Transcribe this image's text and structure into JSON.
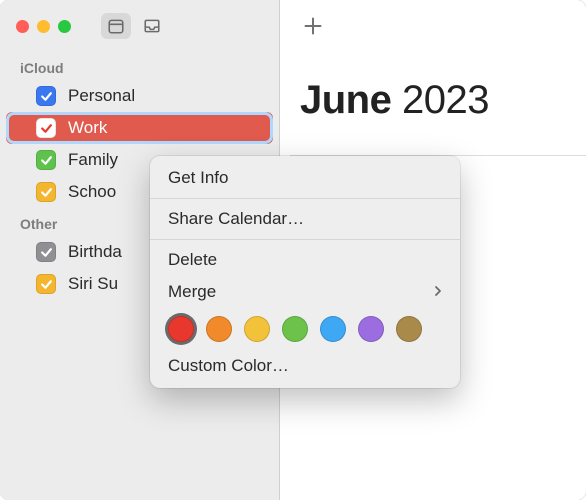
{
  "header": {
    "month": "June",
    "year": "2023"
  },
  "sidebar": {
    "sections": [
      {
        "label": "iCloud",
        "items": [
          {
            "label": "Personal",
            "color": "#3a78f2",
            "checked": true,
            "selected": false
          },
          {
            "label": "Work",
            "color": "#e8382e",
            "checked": true,
            "selected": true
          },
          {
            "label": "Family",
            "color": "#5fc24c",
            "checked": true,
            "selected": false
          },
          {
            "label": "School",
            "color": "#f3b62e",
            "checked": true,
            "selected": false
          }
        ]
      },
      {
        "label": "Other",
        "items": [
          {
            "label": "Birthdays",
            "color": "#8f8f94",
            "checked": true,
            "selected": false
          },
          {
            "label": "Siri Suggestions",
            "color": "#f3b62e",
            "checked": true,
            "selected": false
          }
        ]
      }
    ]
  },
  "context_menu": {
    "items": [
      {
        "label": "Get Info",
        "type": "item"
      },
      {
        "type": "separator"
      },
      {
        "label": "Share Calendar…",
        "type": "item"
      },
      {
        "type": "separator"
      },
      {
        "label": "Delete",
        "type": "item"
      },
      {
        "label": "Merge",
        "type": "submenu"
      },
      {
        "type": "colors",
        "colors": [
          "#e8382e",
          "#f08a2b",
          "#f3c23b",
          "#6cc24a",
          "#3ea8f4",
          "#9c6de0",
          "#a98a4b"
        ],
        "selected_index": 0
      },
      {
        "label": "Custom Color…",
        "type": "item"
      }
    ]
  },
  "sidebar_truncated": {
    "family": "Family",
    "school": "Schoo",
    "birthdays": "Birthda",
    "siri": "Siri Su"
  }
}
